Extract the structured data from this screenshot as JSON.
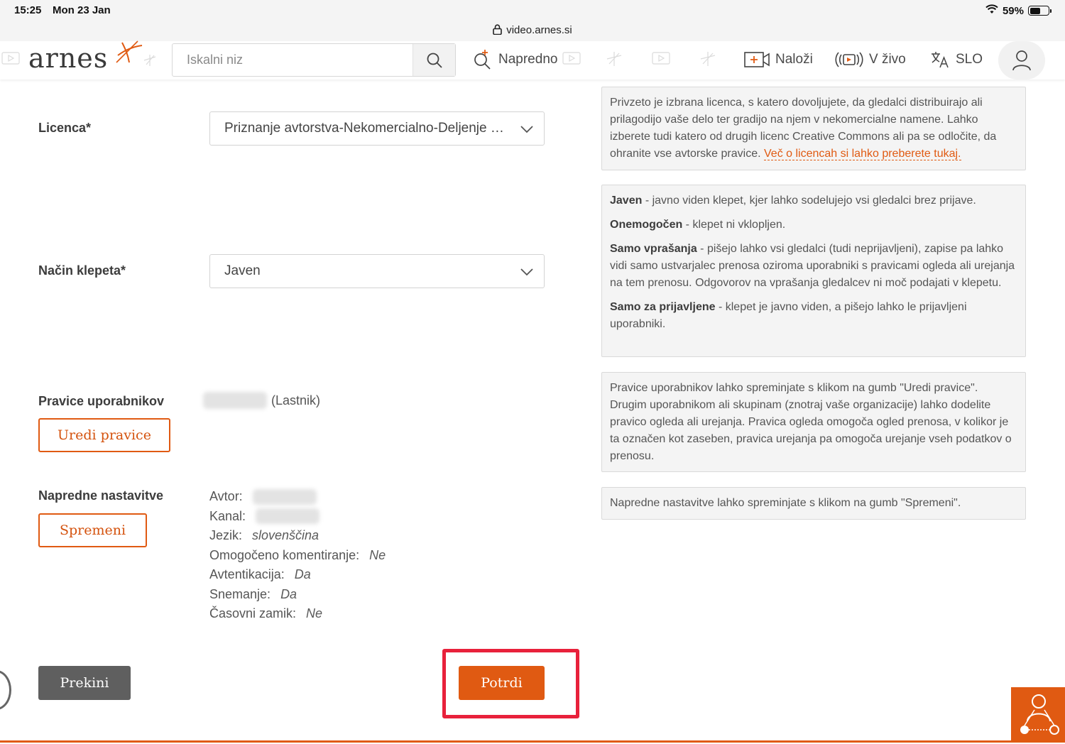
{
  "status_bar": {
    "time": "15:25",
    "date": "Mon 23 Jan",
    "battery": "59%",
    "battery_level": 0.59,
    "url": "video.arnes.si"
  },
  "header": {
    "logo": "arnes",
    "search_placeholder": "Iskalni niz",
    "nav": {
      "advanced": "Napredno",
      "upload": "Naloži",
      "live": "V živo",
      "language": "SLO"
    }
  },
  "form": {
    "license": {
      "label": "Licenca*",
      "value": "Priznanje avtorstva-Nekomercialno-Deljenje pod enakimi pogoji"
    },
    "chat": {
      "label": "Način klepeta*",
      "value": "Javen"
    },
    "rights": {
      "label": "Pravice uporabnikov",
      "owner_suffix": "(Lastnik)",
      "button": "Uredi pravice"
    },
    "advanced": {
      "label": "Napredne nastavitve",
      "button": "Spremeni",
      "fields": [
        {
          "key": "Avtor:",
          "value": ""
        },
        {
          "key": "Kanal:",
          "value": ""
        },
        {
          "key": "Jezik:",
          "value": "slovenščina"
        },
        {
          "key": "Omogočeno komentiranje:",
          "value": "Ne"
        },
        {
          "key": "Avtentikacija:",
          "value": "Da"
        },
        {
          "key": "Snemanje:",
          "value": "Da"
        },
        {
          "key": "Časovni zamik:",
          "value": "Ne"
        }
      ]
    }
  },
  "help": {
    "license_text": "Privzeto je izbrana licenca, s katero dovoljujete, da gledalci distribuirajo ali prilagodijo vaše delo ter gradijo na njem v nekomercialne namene. Lahko izberete tudi katero od drugih licenc Creative Commons ali pa se odločite, da ohranite vse avtorske pravice.",
    "license_link": "Več o licencah si lahko preberete tukaj.",
    "chat": [
      {
        "term": "Javen",
        "desc": " - javno viden klepet, kjer lahko sodelujejo vsi gledalci brez prijave."
      },
      {
        "term": "Onemogočen",
        "desc": " - klepet ni vklopljen."
      },
      {
        "term": "Samo vprašanja",
        "desc": " - pišejo lahko vsi gledalci (tudi neprijavljeni), zapise pa lahko vidi samo ustvarjalec prenosa oziroma uporabniki s pravicami ogleda ali urejanja na tem prenosu. Odgovorov na vprašanja gledalcev ni moč podajati v klepetu."
      },
      {
        "term": "Samo za prijavljene",
        "desc": " - klepet je javno viden, a pišejo lahko le prijavljeni uporabniki."
      }
    ],
    "rights_text": "Pravice uporabnikov lahko spreminjate s klikom na gumb \"Uredi pravice\". Drugim uporabnikom ali skupinam (znotraj vaše organizacije) lahko dodelite pravico ogleda ali urejanja. Pravica ogleda omogoča ogled prenosa, v kolikor je ta označen kot zaseben, pravica urejanja pa omogoča urejanje vseh podatkov o prenosu.",
    "advanced_text": "Napredne nastavitve lahko spreminjate s klikom na gumb \"Spremeni\"."
  },
  "actions": {
    "cancel": "Prekini",
    "confirm": "Potrdi"
  },
  "colors": {
    "accent": "#e05a12",
    "highlight": "#e8213b",
    "cancel_bg": "#5f5f5f"
  }
}
